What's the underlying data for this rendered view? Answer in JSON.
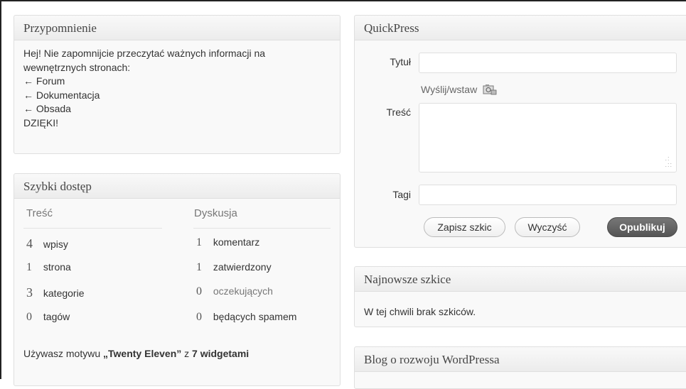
{
  "reminder": {
    "title": "Przypomnienie",
    "lines": [
      "Hej! Nie zapomnijcie przeczytać ważnych informacji na",
      "wewnętrznych stronach:",
      "← Forum",
      "← Dokumentacja",
      "← Obsada",
      "DZIĘKI!"
    ]
  },
  "quick_access": {
    "title": "Szybki dostęp",
    "content_header": "Treść",
    "discussion_header": "Dyskusja",
    "content_rows": [
      {
        "count": "4",
        "label": "wpisy"
      },
      {
        "count": "1",
        "label": "strona"
      },
      {
        "count": "3",
        "label": "kategorie"
      },
      {
        "count": "0",
        "label": "tagów"
      }
    ],
    "discussion_rows": [
      {
        "count": "1",
        "label": "komentarz"
      },
      {
        "count": "1",
        "label": "zatwierdzony"
      },
      {
        "count": "0",
        "label": "oczekujących"
      },
      {
        "count": "0",
        "label": "będących spamem"
      }
    ],
    "theme_prefix": "Używasz motywu ",
    "theme_name": "„Twenty Eleven”",
    "theme_middle": " z ",
    "theme_widgets": "7 widgetami"
  },
  "quickpress": {
    "title": "QuickPress",
    "title_label": "Tytuł",
    "title_value": "",
    "upload_label": "Wyślij/wstaw",
    "content_label": "Treść",
    "content_value": "",
    "tags_label": "Tagi",
    "tags_value": "",
    "save_draft": "Zapisz szkic",
    "clear": "Wyczyść",
    "publish": "Opublikuj"
  },
  "recent_drafts": {
    "title": "Najnowsze szkice",
    "empty_text": "W tej chwili brak szkiców."
  },
  "wp_blog": {
    "title": "Blog o rozwoju WordPressa"
  }
}
